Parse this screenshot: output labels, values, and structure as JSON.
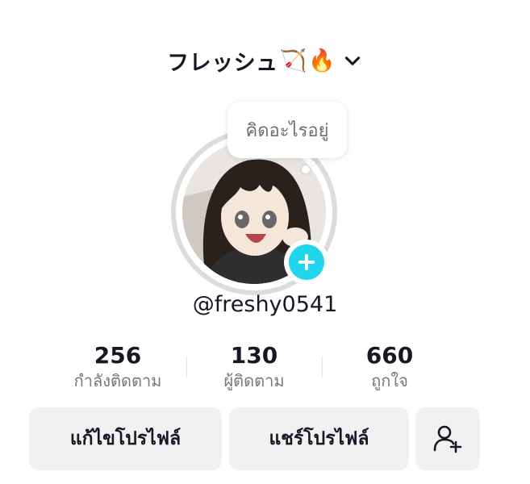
{
  "header": {
    "username_title": "フレッシュ",
    "emoji_bow": "🏹",
    "emoji_fire": "🔥"
  },
  "bubble": {
    "text": "คิดอะไรอยู่"
  },
  "profile": {
    "handle": "@freshy0541"
  },
  "stats": [
    {
      "value": "256",
      "label": "กำลังติดตาม"
    },
    {
      "value": "130",
      "label": "ผู้ติดตาม"
    },
    {
      "value": "660",
      "label": "ถูกใจ"
    }
  ],
  "buttons": {
    "edit_profile": "แก้ไขโปรไฟล์",
    "share_profile": "แชร์โปรไฟล์"
  },
  "colors": {
    "accent": "#20d5ec",
    "button_bg": "#f1f1f2"
  },
  "icons": [
    "chevron-down-icon",
    "plus-icon",
    "add-friend-icon"
  ]
}
